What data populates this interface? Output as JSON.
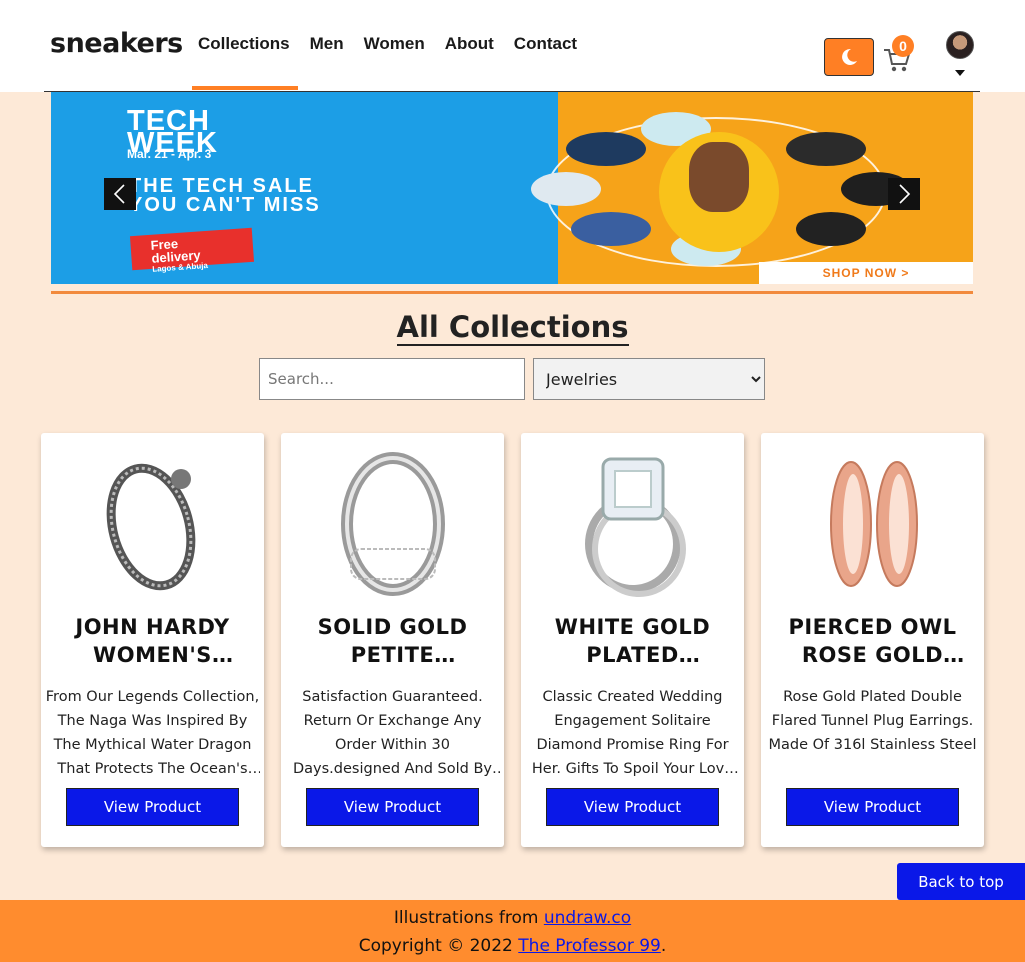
{
  "header": {
    "logo": "sneakers",
    "nav": [
      {
        "label": "Collections",
        "active": true
      },
      {
        "label": "Men",
        "active": false
      },
      {
        "label": "Women",
        "active": false
      },
      {
        "label": "About",
        "active": false
      },
      {
        "label": "Contact",
        "active": false
      }
    ],
    "theme_toggle_icon": "moon-icon",
    "cart_icon": "cart-icon",
    "cart_count": "0",
    "avatar_icon": "user-avatar",
    "accent_color": "#ff7f24"
  },
  "banner": {
    "headline_1": "TECH",
    "headline_2": "WEEK",
    "dates": "Mar. 21 - Apr. 3",
    "sale_1": "THE TECH SALE",
    "sale_2": "YOU CAN'T MISS",
    "free_1": "Free",
    "free_2": "delivery",
    "free_3": "Lagos & Abuja",
    "shop_now": "SHOP NOW >",
    "prev_icon": "chevron-left-icon",
    "next_icon": "chevron-right-icon"
  },
  "collections": {
    "title": "All Collections",
    "search_placeholder": "Search...",
    "category_selected": "Jewelries"
  },
  "products": [
    {
      "title": "JOHN HARDY WOMEN'S LEGENDS NAGA",
      "description": "From Our Legends Collection, The Naga Was Inspired By The Mythical Water Dragon That Protects The Ocean's Pearl.",
      "button": "View Product"
    },
    {
      "title": "SOLID GOLD PETITE MICROPAVE",
      "description": "Satisfaction Guaranteed. Return Or Exchange Any Order Within 30 Days.designed And Sold By Hafeez Center In The United States.",
      "button": "View Product"
    },
    {
      "title": "WHITE GOLD PLATED PRINCESS",
      "description": "Classic Created Wedding Engagement Solitaire Diamond Promise Ring For Her. Gifts To Spoil Your Love More.",
      "button": "View Product"
    },
    {
      "title": "PIERCED OWL ROSE GOLD PLATED STAINLESS STEEL DOUBLE",
      "description": "Rose Gold Plated Double Flared Tunnel Plug Earrings. Made Of 316l Stainless Steel",
      "button": "View Product"
    }
  ],
  "back_to_top": "Back to top",
  "footer": {
    "line1_prefix": "Illustrations from ",
    "line1_link": "undraw.co",
    "line2_prefix": "Copyright © 2022 ",
    "line2_link": "The Professor 99",
    "line2_suffix": "."
  }
}
